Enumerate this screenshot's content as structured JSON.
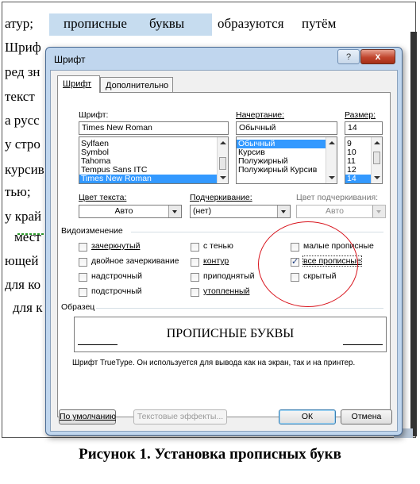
{
  "document": {
    "line1": [
      "атур;",
      "прописные",
      "буквы",
      "образуются",
      "путём"
    ],
    "lines": [
      "Шриф",
      "ред зн",
      "текст",
      "а русс",
      "у стро",
      "курсив",
      "тью;",
      "у край",
      "мест",
      "ющей",
      "для ко",
      "для к"
    ]
  },
  "dialog": {
    "title": "Шрифт",
    "help_label": "?",
    "close_label": "x",
    "tabs": [
      "Шрифт",
      "Дополнительно"
    ],
    "font_label": "Шрифт:",
    "font_value": "Times New Roman",
    "font_list": [
      "Sylfaen",
      "Symbol",
      "Tahoma",
      "Tempus Sans ITC",
      "Times New Roman"
    ],
    "style_label": "Начертание:",
    "style_value": "Обычный",
    "style_list": [
      "Обычный",
      "Курсив",
      "Полужирный",
      "Полужирный Курсив"
    ],
    "size_label": "Размер:",
    "size_value": "14",
    "size_list": [
      "9",
      "10",
      "11",
      "12",
      "14"
    ],
    "text_color_label": "Цвет текста:",
    "text_color_value": "Авто",
    "underline_label": "Подчеркивание:",
    "underline_value": "(нет)",
    "underline_color_label": "Цвет подчеркивания:",
    "underline_color_value": "Авто",
    "effects_label": "Видоизменение",
    "effects": {
      "strikethrough": {
        "label": "зачеркнутый",
        "checked": false
      },
      "double_strikethrough": {
        "label": "двойное зачеркивание",
        "checked": false
      },
      "superscript": {
        "label": "надстрочный",
        "checked": false
      },
      "subscript": {
        "label": "подстрочный",
        "checked": false
      },
      "shadow": {
        "label": "с тенью",
        "checked": false
      },
      "outline": {
        "label": "контур",
        "checked": false
      },
      "emboss": {
        "label": "приподнятый",
        "checked": false
      },
      "engrave": {
        "label": "утопленный",
        "checked": false
      },
      "small_caps": {
        "label": "малые прописные",
        "checked": false
      },
      "all_caps": {
        "label": "все прописные",
        "checked": true
      },
      "hidden": {
        "label": "скрытый",
        "checked": false
      }
    },
    "preview_label": "Образец",
    "preview_text": "ПРОПИСНЫЕ БУКВЫ",
    "preview_note": "Шрифт TrueType. Он используется для вывода как на экран, так и на принтер.",
    "default_button": "По умолчанию",
    "text_effects_button": "Текстовые эффекты...",
    "ok_button": "ОК",
    "cancel_button": "Отмена"
  },
  "caption": "Рисунок 1. Установка прописных букв",
  "colors": {
    "highlight": "#c6dcef",
    "annotation": "#d8121b",
    "selection": "#3399ff"
  }
}
